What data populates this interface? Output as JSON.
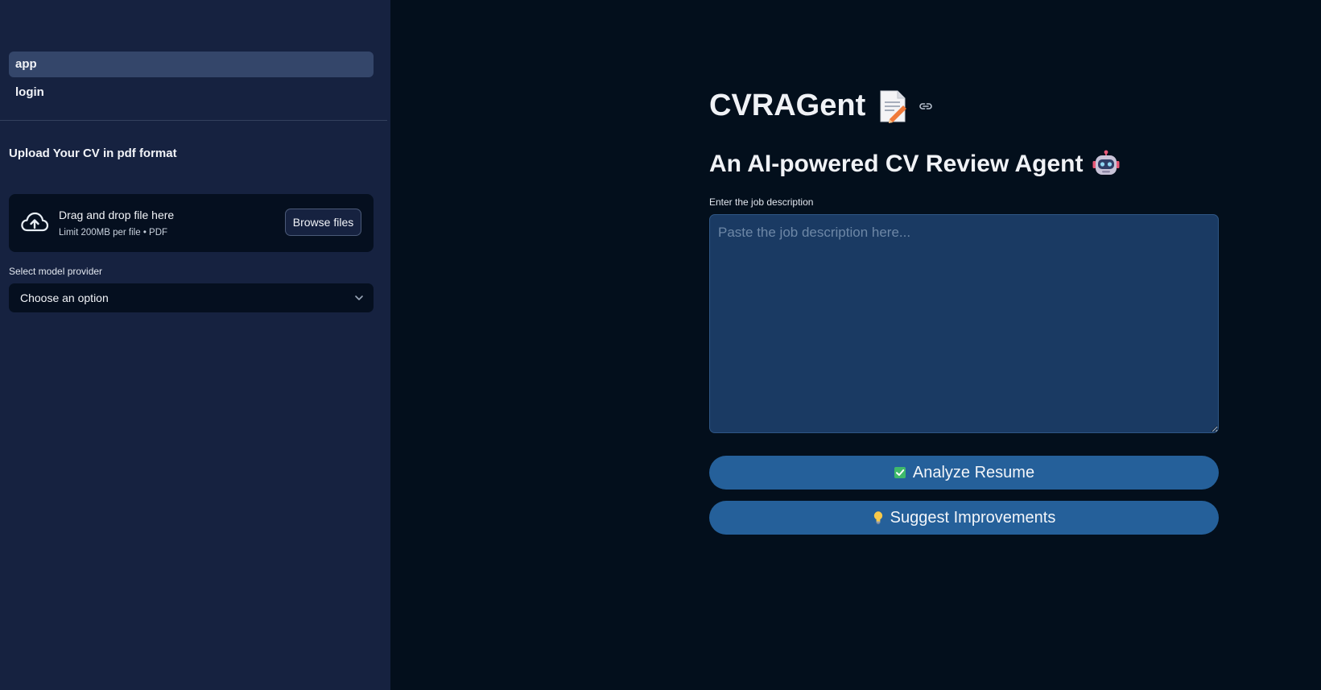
{
  "sidebar": {
    "nav": [
      {
        "label": "app",
        "active": true
      },
      {
        "label": "login",
        "active": false
      }
    ],
    "upload_heading": "Upload Your CV in pdf format",
    "uploader": {
      "title": "Drag and drop file here",
      "limit": "Limit 200MB per file • PDF",
      "browse_label": "Browse files",
      "icon": "cloud-upload-icon"
    },
    "model_select": {
      "label": "Select model provider",
      "value": "Choose an option",
      "icon": "chevron-down-icon"
    }
  },
  "main": {
    "title": "CVRAGent",
    "title_icon": "memo-icon",
    "anchor_icon": "link-icon",
    "subtitle": "An AI-powered CV Review Agent",
    "subtitle_icon": "robot-icon",
    "job_description": {
      "label": "Enter the job description",
      "placeholder": "Paste the job description here...",
      "value": ""
    },
    "buttons": {
      "analyze": {
        "label": "Analyze Resume",
        "icon": "check-box-icon"
      },
      "suggest": {
        "label": "Suggest Improvements",
        "icon": "light-bulb-icon"
      }
    }
  },
  "colors": {
    "sidebar_bg": "#162240",
    "main_bg": "#030f1c",
    "nav_active_bg": "#34466a",
    "textarea_bg": "#1a3a63",
    "button_bg": "#25609a"
  }
}
